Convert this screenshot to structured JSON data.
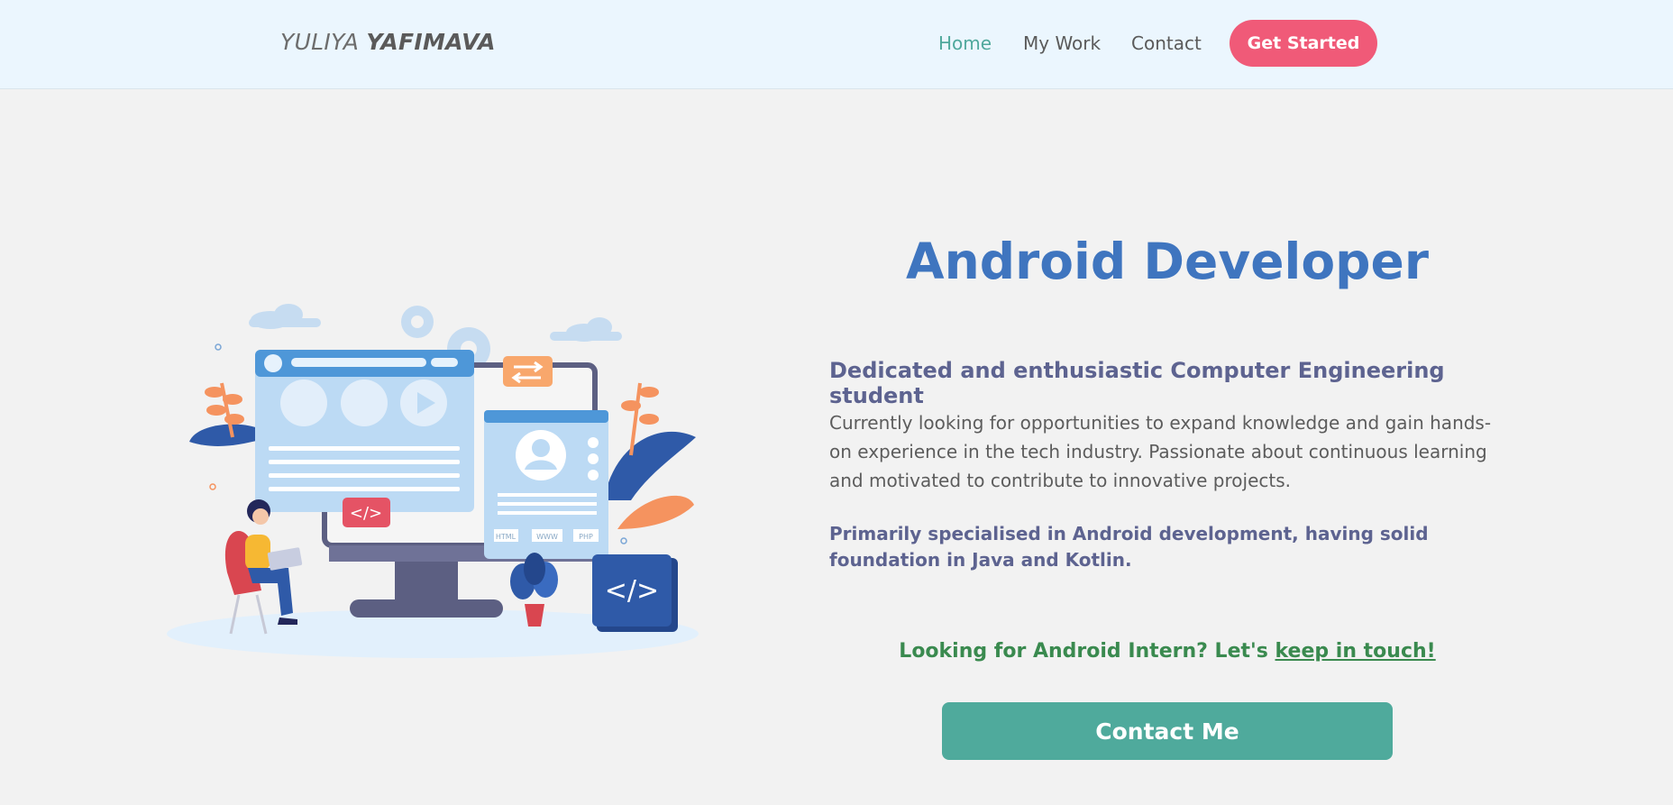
{
  "nav": {
    "brand_first": "YULIYA",
    "brand_last": "YAFIMAVA",
    "links": [
      "Home",
      "My Work",
      "Contact"
    ],
    "cta_label": "Get Started"
  },
  "hero": {
    "title": "Android Developer",
    "subtitle": "Dedicated and enthusiastic Computer Engineering student",
    "description": "Currently looking for opportunities to expand knowledge and gain hands-on experience in the tech industry. Passionate about continuous learning and motivated to contribute to innovative projects.",
    "specialisation": "Primarily specialised in Android development, having solid foundation in Java and Kotlin.",
    "intern_prefix": "Looking for Android Intern? Let's",
    "intern_link": "keep in touch!",
    "contact_button": "Contact Me"
  },
  "illustration": {
    "code_symbol": "</>",
    "web_tags": [
      "HTML",
      "WWW",
      "PHP"
    ]
  },
  "colors": {
    "nav_background": "#ebf6fe",
    "page_background": "#f2f2f2",
    "active_link": "#4fa89c",
    "cta": "#f05a78",
    "title": "#3f75bf",
    "subtitle": "#5d6390",
    "intern_text": "#3a8a4f",
    "contact_button": "#4faa9c"
  }
}
